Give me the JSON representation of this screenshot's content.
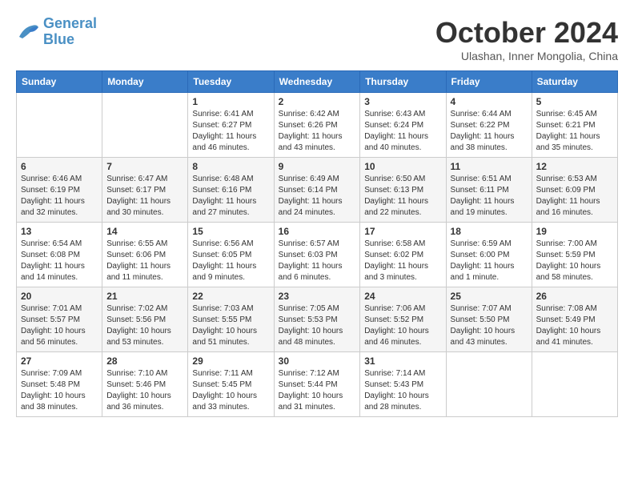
{
  "logo": {
    "line1": "General",
    "line2": "Blue"
  },
  "title": "October 2024",
  "location": "Ulashan, Inner Mongolia, China",
  "days_of_week": [
    "Sunday",
    "Monday",
    "Tuesday",
    "Wednesday",
    "Thursday",
    "Friday",
    "Saturday"
  ],
  "weeks": [
    [
      {
        "day": "",
        "info": ""
      },
      {
        "day": "",
        "info": ""
      },
      {
        "day": "1",
        "info": "Sunrise: 6:41 AM\nSunset: 6:27 PM\nDaylight: 11 hours and 46 minutes."
      },
      {
        "day": "2",
        "info": "Sunrise: 6:42 AM\nSunset: 6:26 PM\nDaylight: 11 hours and 43 minutes."
      },
      {
        "day": "3",
        "info": "Sunrise: 6:43 AM\nSunset: 6:24 PM\nDaylight: 11 hours and 40 minutes."
      },
      {
        "day": "4",
        "info": "Sunrise: 6:44 AM\nSunset: 6:22 PM\nDaylight: 11 hours and 38 minutes."
      },
      {
        "day": "5",
        "info": "Sunrise: 6:45 AM\nSunset: 6:21 PM\nDaylight: 11 hours and 35 minutes."
      }
    ],
    [
      {
        "day": "6",
        "info": "Sunrise: 6:46 AM\nSunset: 6:19 PM\nDaylight: 11 hours and 32 minutes."
      },
      {
        "day": "7",
        "info": "Sunrise: 6:47 AM\nSunset: 6:17 PM\nDaylight: 11 hours and 30 minutes."
      },
      {
        "day": "8",
        "info": "Sunrise: 6:48 AM\nSunset: 6:16 PM\nDaylight: 11 hours and 27 minutes."
      },
      {
        "day": "9",
        "info": "Sunrise: 6:49 AM\nSunset: 6:14 PM\nDaylight: 11 hours and 24 minutes."
      },
      {
        "day": "10",
        "info": "Sunrise: 6:50 AM\nSunset: 6:13 PM\nDaylight: 11 hours and 22 minutes."
      },
      {
        "day": "11",
        "info": "Sunrise: 6:51 AM\nSunset: 6:11 PM\nDaylight: 11 hours and 19 minutes."
      },
      {
        "day": "12",
        "info": "Sunrise: 6:53 AM\nSunset: 6:09 PM\nDaylight: 11 hours and 16 minutes."
      }
    ],
    [
      {
        "day": "13",
        "info": "Sunrise: 6:54 AM\nSunset: 6:08 PM\nDaylight: 11 hours and 14 minutes."
      },
      {
        "day": "14",
        "info": "Sunrise: 6:55 AM\nSunset: 6:06 PM\nDaylight: 11 hours and 11 minutes."
      },
      {
        "day": "15",
        "info": "Sunrise: 6:56 AM\nSunset: 6:05 PM\nDaylight: 11 hours and 9 minutes."
      },
      {
        "day": "16",
        "info": "Sunrise: 6:57 AM\nSunset: 6:03 PM\nDaylight: 11 hours and 6 minutes."
      },
      {
        "day": "17",
        "info": "Sunrise: 6:58 AM\nSunset: 6:02 PM\nDaylight: 11 hours and 3 minutes."
      },
      {
        "day": "18",
        "info": "Sunrise: 6:59 AM\nSunset: 6:00 PM\nDaylight: 11 hours and 1 minute."
      },
      {
        "day": "19",
        "info": "Sunrise: 7:00 AM\nSunset: 5:59 PM\nDaylight: 10 hours and 58 minutes."
      }
    ],
    [
      {
        "day": "20",
        "info": "Sunrise: 7:01 AM\nSunset: 5:57 PM\nDaylight: 10 hours and 56 minutes."
      },
      {
        "day": "21",
        "info": "Sunrise: 7:02 AM\nSunset: 5:56 PM\nDaylight: 10 hours and 53 minutes."
      },
      {
        "day": "22",
        "info": "Sunrise: 7:03 AM\nSunset: 5:55 PM\nDaylight: 10 hours and 51 minutes."
      },
      {
        "day": "23",
        "info": "Sunrise: 7:05 AM\nSunset: 5:53 PM\nDaylight: 10 hours and 48 minutes."
      },
      {
        "day": "24",
        "info": "Sunrise: 7:06 AM\nSunset: 5:52 PM\nDaylight: 10 hours and 46 minutes."
      },
      {
        "day": "25",
        "info": "Sunrise: 7:07 AM\nSunset: 5:50 PM\nDaylight: 10 hours and 43 minutes."
      },
      {
        "day": "26",
        "info": "Sunrise: 7:08 AM\nSunset: 5:49 PM\nDaylight: 10 hours and 41 minutes."
      }
    ],
    [
      {
        "day": "27",
        "info": "Sunrise: 7:09 AM\nSunset: 5:48 PM\nDaylight: 10 hours and 38 minutes."
      },
      {
        "day": "28",
        "info": "Sunrise: 7:10 AM\nSunset: 5:46 PM\nDaylight: 10 hours and 36 minutes."
      },
      {
        "day": "29",
        "info": "Sunrise: 7:11 AM\nSunset: 5:45 PM\nDaylight: 10 hours and 33 minutes."
      },
      {
        "day": "30",
        "info": "Sunrise: 7:12 AM\nSunset: 5:44 PM\nDaylight: 10 hours and 31 minutes."
      },
      {
        "day": "31",
        "info": "Sunrise: 7:14 AM\nSunset: 5:43 PM\nDaylight: 10 hours and 28 minutes."
      },
      {
        "day": "",
        "info": ""
      },
      {
        "day": "",
        "info": ""
      }
    ]
  ]
}
